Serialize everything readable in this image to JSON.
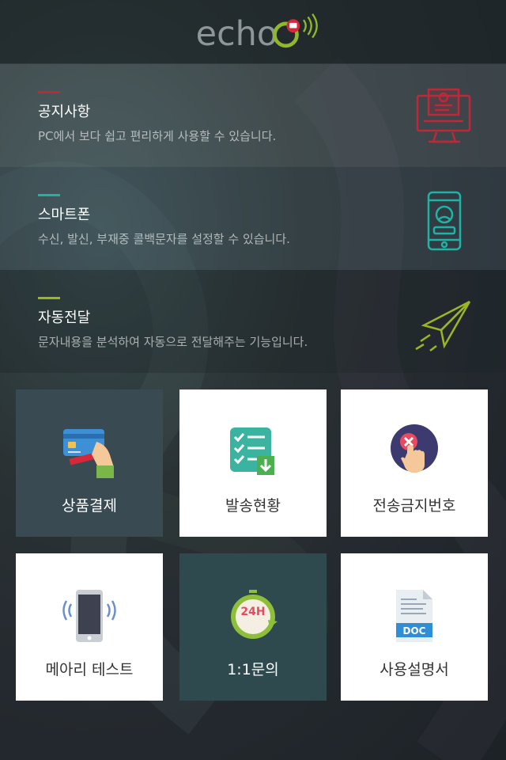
{
  "header": {
    "logo_text": "echo"
  },
  "notices": [
    {
      "title": "공지사항",
      "desc": "PC에서 보다 쉽고 편리하게 사용할 수 있습니다.",
      "accent": "#c0283a",
      "icon": "monitor-icon"
    },
    {
      "title": "스마트폰",
      "desc": "수신, 발신, 부재중 콜백문자를 설정할 수 있습니다.",
      "accent": "#1fb3a5",
      "icon": "smartphone-contact-icon"
    },
    {
      "title": "자동전달",
      "desc": "문자내용을 분석하여 자동으로 전달해주는 기능입니다.",
      "accent": "#9bb61f",
      "icon": "paper-plane-icon"
    }
  ],
  "tiles": [
    {
      "label": "상품결제",
      "icon": "credit-card-icon"
    },
    {
      "label": "발송현황",
      "icon": "checklist-icon"
    },
    {
      "label": "전송금지번호",
      "icon": "block-number-icon"
    },
    {
      "label": "메아리 테스트",
      "icon": "phone-vibrate-icon"
    },
    {
      "label": "1:1문의",
      "icon": "24h-support-icon"
    },
    {
      "label": "사용설명서",
      "icon": "doc-file-icon"
    }
  ],
  "doc_badge": "DOC",
  "support_badge": "24H"
}
